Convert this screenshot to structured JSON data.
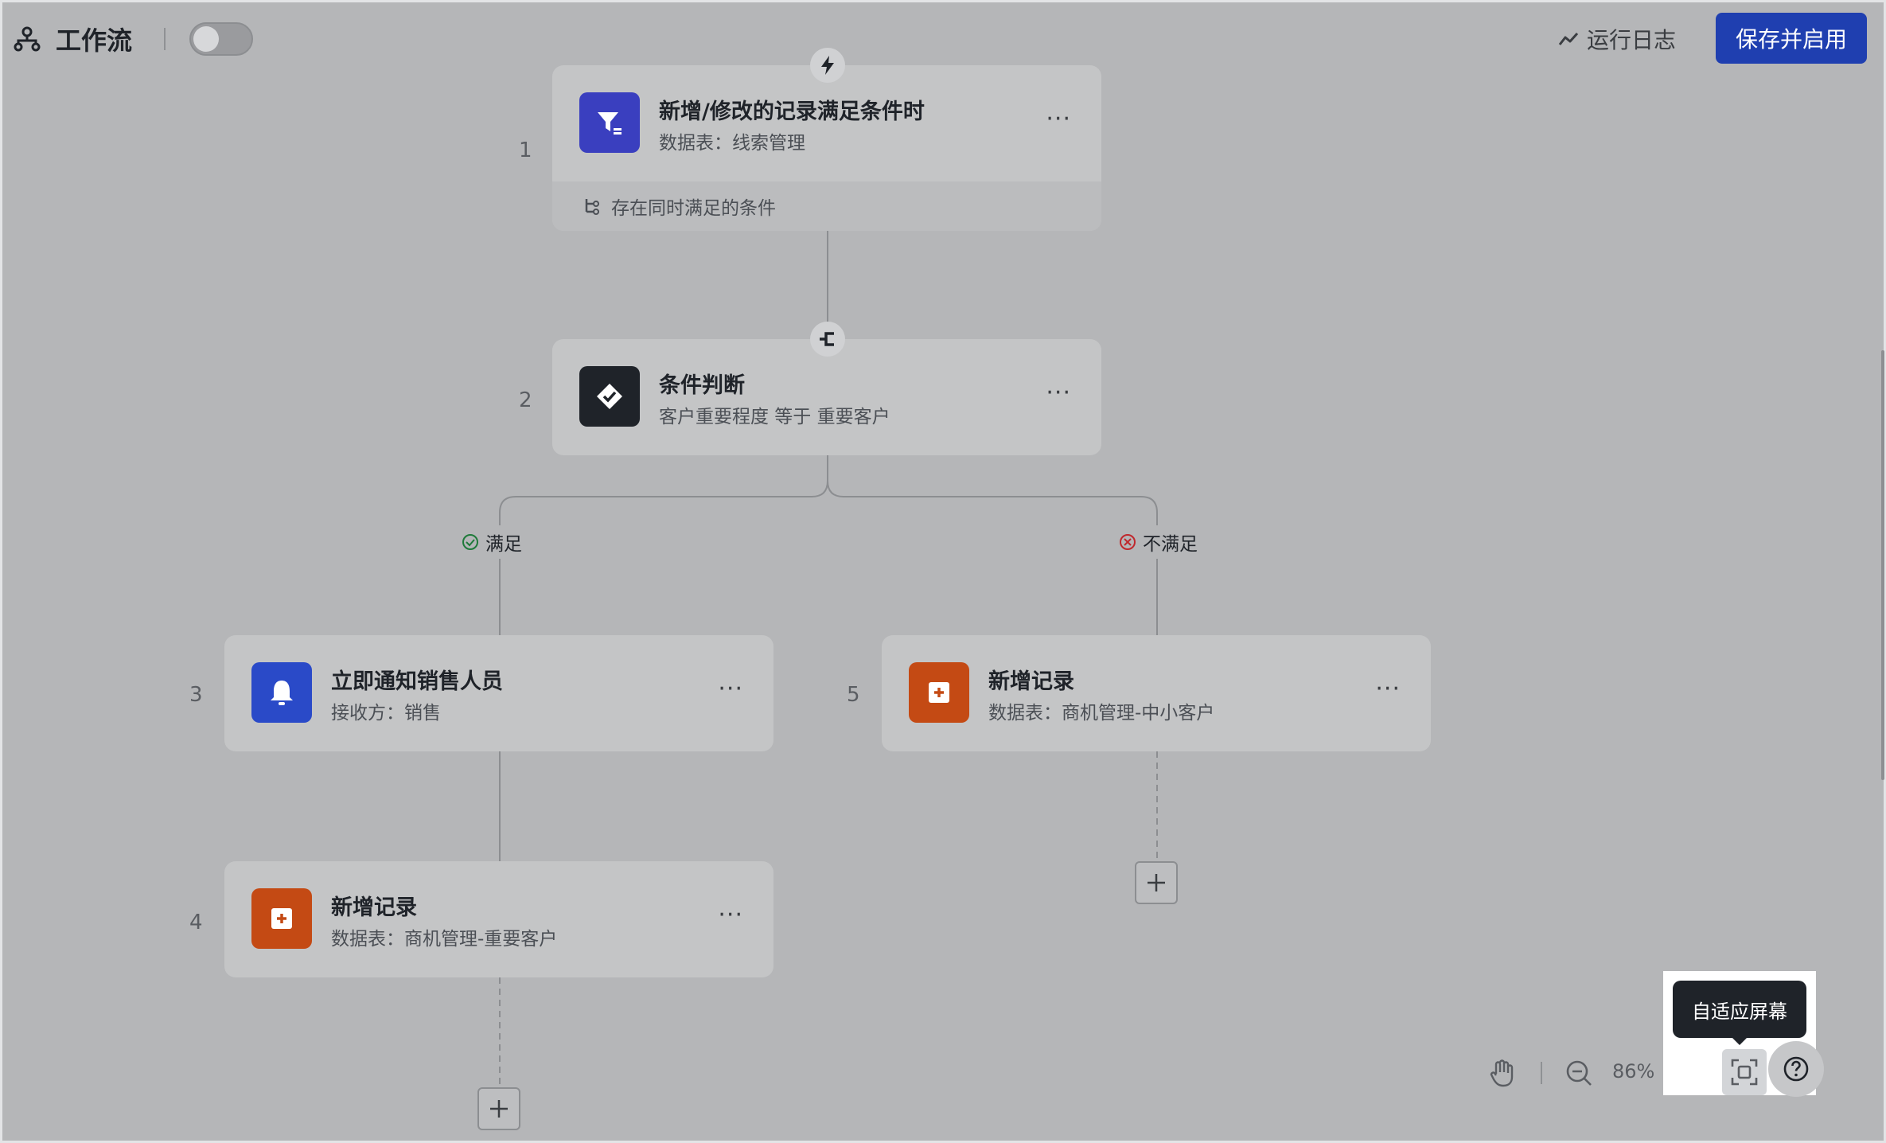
{
  "app": {
    "title": "工作流"
  },
  "header": {
    "run_log_label": "运行日志",
    "save_label": "保存并启用",
    "enabled": false
  },
  "nodes": [
    {
      "step": "1",
      "title": "新增/修改的记录满足条件时",
      "subtitle": "数据表：线索管理",
      "footer": "存在同时满足的条件",
      "icon": "filter-icon",
      "color": "#3a3fbf"
    },
    {
      "step": "2",
      "title": "条件判断",
      "subtitle": "客户重要程度 等于 重要客户",
      "icon": "diamond-check-icon",
      "color": "#1f2329"
    },
    {
      "step": "3",
      "title": "立即通知销售人员",
      "subtitle": "接收方：销售",
      "icon": "bell-icon",
      "color": "#2a4ac8"
    },
    {
      "step": "4",
      "title": "新增记录",
      "subtitle": "数据表：商机管理-重要客户",
      "icon": "add-record-icon",
      "color": "#c44a14"
    },
    {
      "step": "5",
      "title": "新增记录",
      "subtitle": "数据表：商机管理-中小客户",
      "icon": "add-record-icon",
      "color": "#c44a14"
    }
  ],
  "more_label": "···",
  "branches": {
    "yes_label": "满足",
    "no_label": "不满足"
  },
  "toolbar": {
    "zoom": "86%",
    "fit_tooltip": "自适应屏幕"
  }
}
